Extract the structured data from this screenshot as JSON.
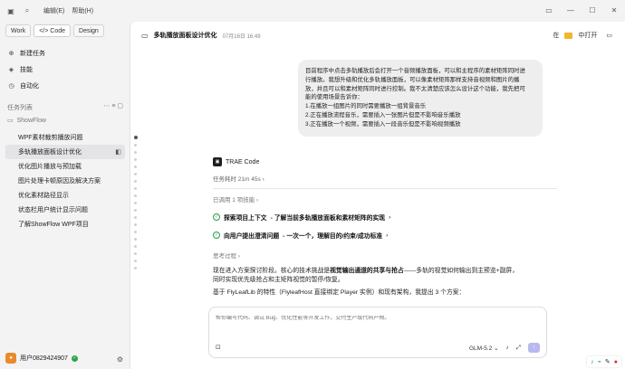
{
  "menu": {
    "edit": "编辑(E)",
    "help": "帮助(H)"
  },
  "mode_tabs": [
    "Work",
    "</> Code",
    "Design"
  ],
  "nav": [
    {
      "icon": "plus-icon",
      "label": "新建任务"
    },
    {
      "icon": "skill-icon",
      "label": "技能"
    },
    {
      "icon": "automation-icon",
      "label": "自动化"
    }
  ],
  "section_label": "任务列表",
  "group_name": "ShowFlow",
  "tasks": [
    "WPF素材裁剪播放问题",
    "多轨播放面板设计优化",
    "优化图片播放与预加载",
    "图片处理卡顿原因及解决方案",
    "优化素材路径显示",
    "状态栏用户统计显示问题",
    "了解ShowFlow WPF项目"
  ],
  "user": {
    "name": "用户0829424907"
  },
  "header": {
    "title": "多轨播放面板设计优化",
    "time": "07月16日 16:49",
    "open_in": "在",
    "open_label": "中打开"
  },
  "user_message": [
    "目前程序中点击多轨播放后会打开一个音频播放面板，可以和主程序的素材矩阵同时进",
    "行播放。我想升级和优化多轨播放面板，可以像素材矩阵那样支持音视频和图片的播",
    "放，并且可以和素材矩阵同时进行控制。我不太清楚应该怎么设计这个功能，我先把可",
    "能的使用场景告诉你：",
    "1.在播放一组图片的同时需要播放一组背景音乐",
    "2.正在播放流程音乐，需要插入一张图片但是不影响音乐播放",
    "3.正在播放一个视频，需要插入一段音乐但是不影响视频播放"
  ],
  "assistant": {
    "name": "TRAE Code",
    "elapsed": "任务耗时 21m 45s",
    "used_tools": "已调用 1 项技能",
    "steps": [
      {
        "bold": "探索项目上下文",
        "rest": " - 了解当前多轨播放面板和素材矩阵的实现"
      },
      {
        "bold": "向用户提出澄清问题",
        "rest": " - 一次一个，理解目的/约束/成功标准"
      }
    ],
    "thinking": "思考过程",
    "para1_a": "现在进入方案探讨阶段。核心的技术挑战是",
    "para1_b": "视觉输出通道的共享与抢占",
    "para1_c": "——多轨的视觉如何输出到主预览+副屏，",
    "para1_d": "同时实现优先级抢占和主矩阵视觉的暂停/恢复。",
    "para2": "基于 FlyLeafLib 的特性（FlyleafHost 直接绑定 Player 实例）和现有架构，我提出 3 个方案："
  },
  "input": {
    "placeholder": "帮你编写代码、调试 Bug、优化性能等开发工作，交付生产级代码产物。"
  },
  "model": "GLM-5.2",
  "colors": {
    "accent": "#6b6be0",
    "check": "#2b9a4a",
    "avatar": "#e98b2a"
  }
}
